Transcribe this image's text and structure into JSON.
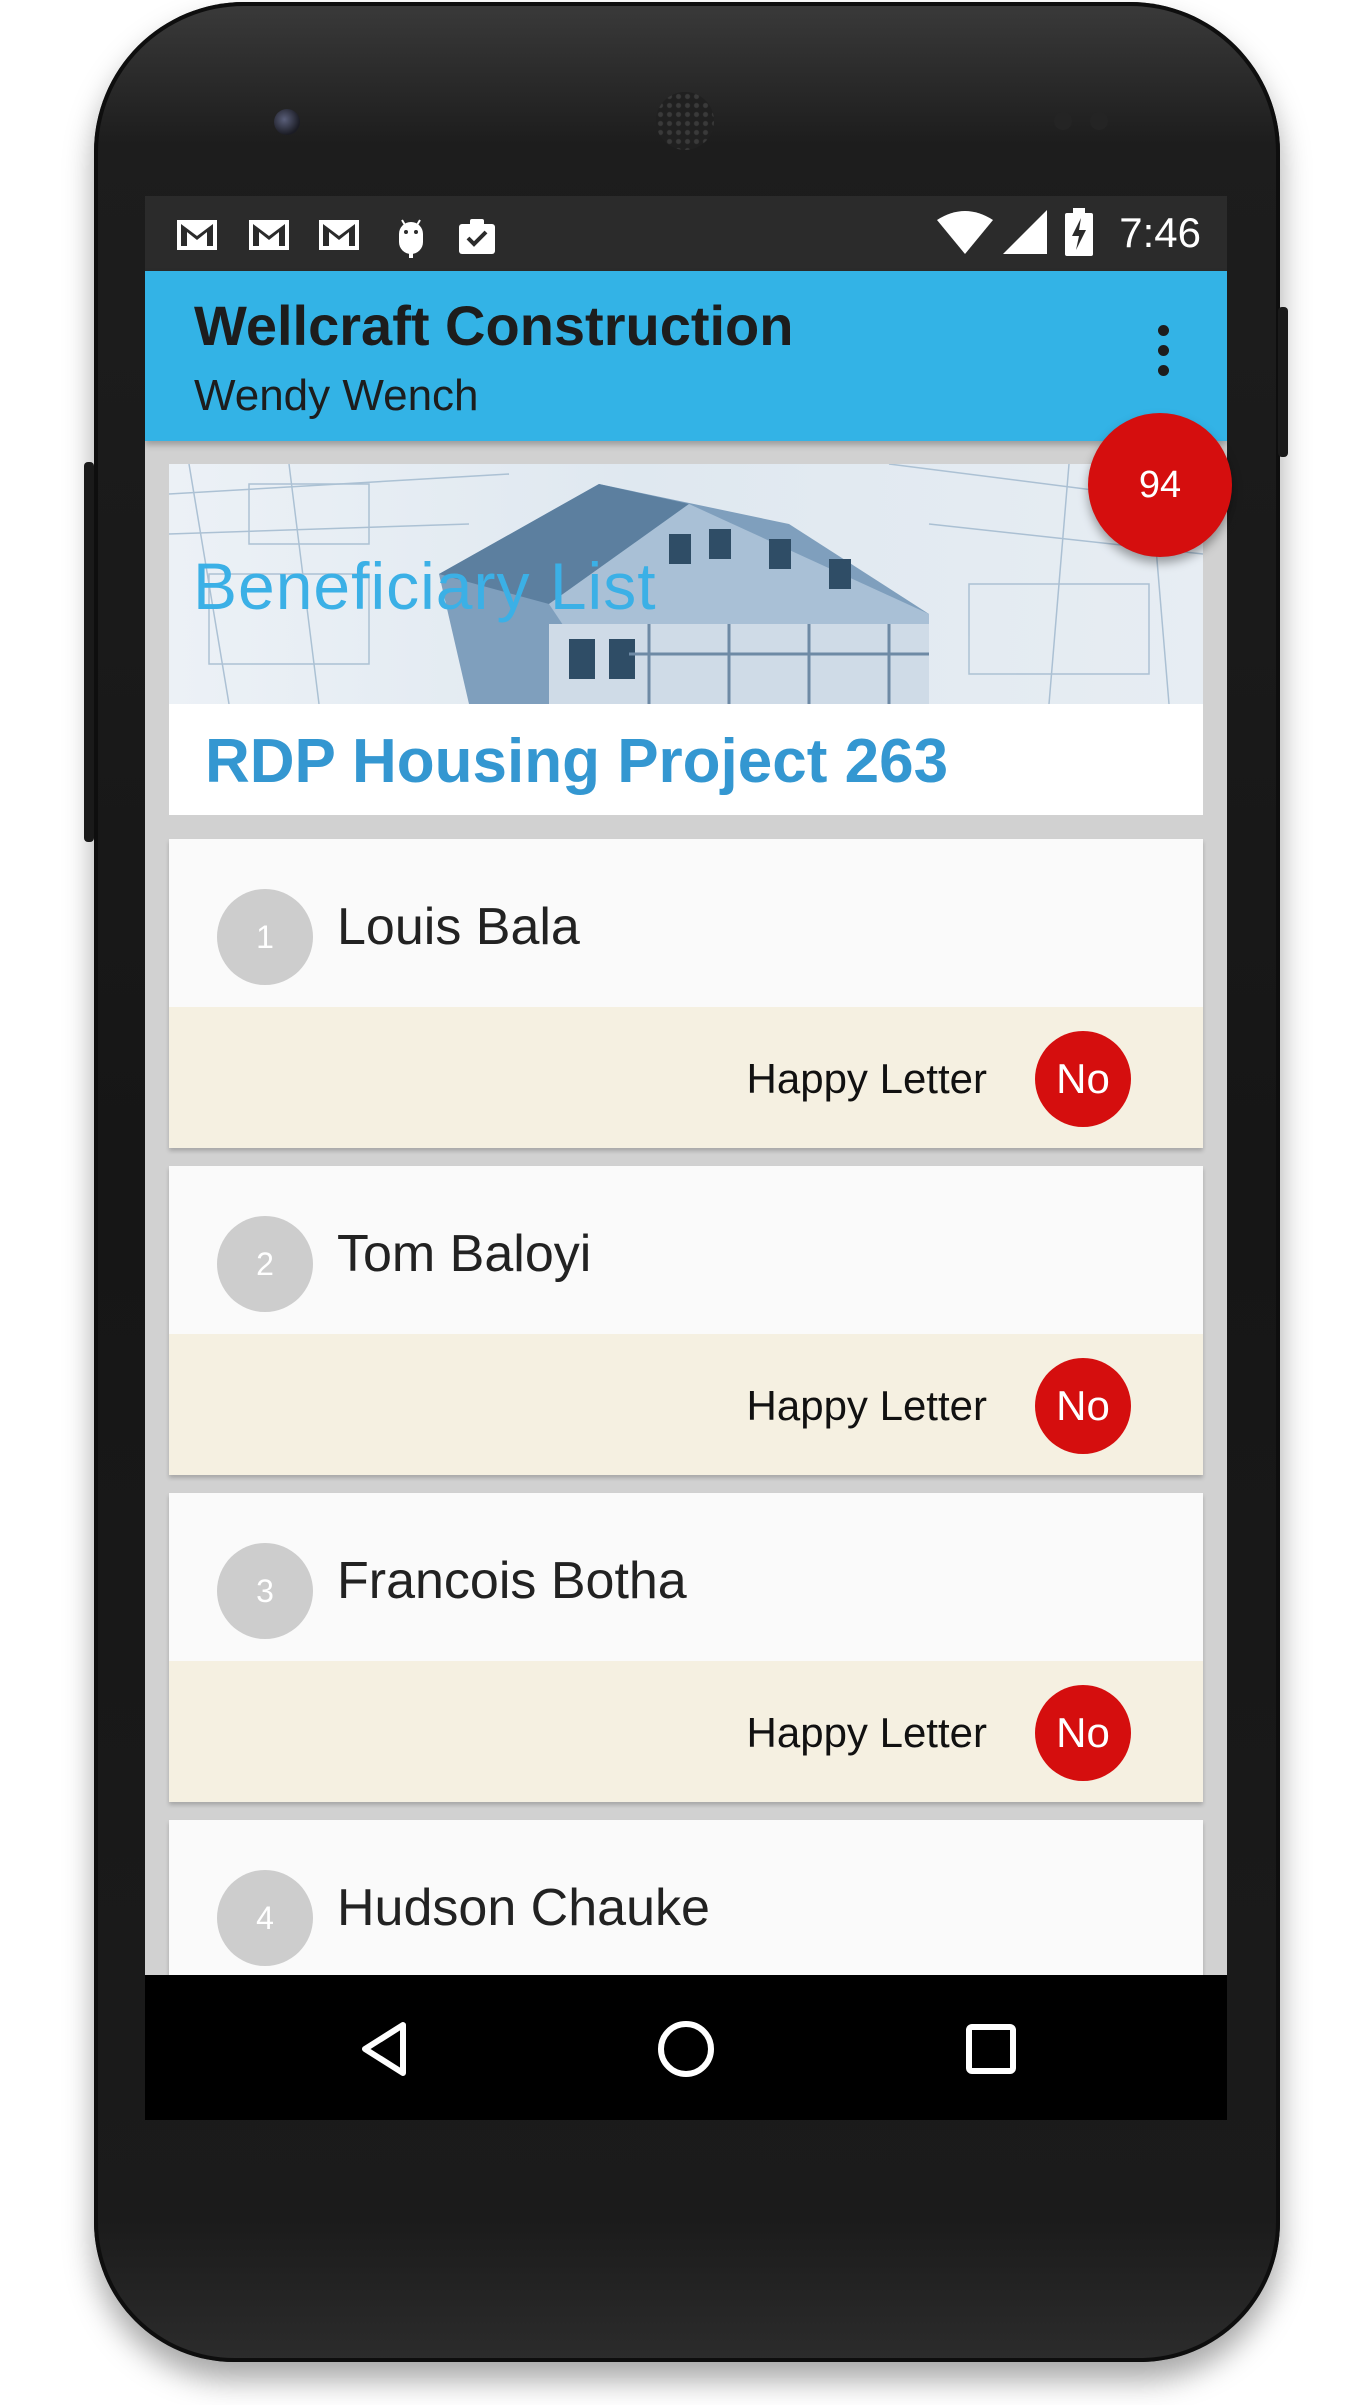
{
  "status_bar": {
    "time": "7:46",
    "icons": [
      "gmail-icon",
      "gmail-icon",
      "gmail-icon",
      "android-icon",
      "clipboard-check-icon"
    ],
    "right_icons": [
      "wifi-icon",
      "cell-signal-icon",
      "battery-charging-icon"
    ]
  },
  "app_bar": {
    "title": "Wellcraft Construction",
    "subtitle": "Wendy Wench",
    "menu_icon": "overflow-menu-icon"
  },
  "header": {
    "hero_title": "Beneficiary List",
    "project_title": "RDP Housing Project 263",
    "count": "94"
  },
  "beneficiaries": [
    {
      "number": "1",
      "name": "Louis Bala",
      "letter_label": "Happy Letter",
      "status": "No"
    },
    {
      "number": "2",
      "name": "Tom Baloyi",
      "letter_label": "Happy Letter",
      "status": "No"
    },
    {
      "number": "3",
      "name": "Francois Botha",
      "letter_label": "Happy Letter",
      "status": "No"
    },
    {
      "number": "4",
      "name": "Hudson Chauke"
    }
  ],
  "nav_bar": {
    "back_icon": "back-triangle-icon",
    "home_icon": "home-circle-icon",
    "recents_icon": "recents-square-icon"
  },
  "colors": {
    "app_bar": "#33b3e6",
    "accent_red": "#d50e0e",
    "project_title": "#3497d1",
    "card_bottom": "#f5f0e1"
  }
}
